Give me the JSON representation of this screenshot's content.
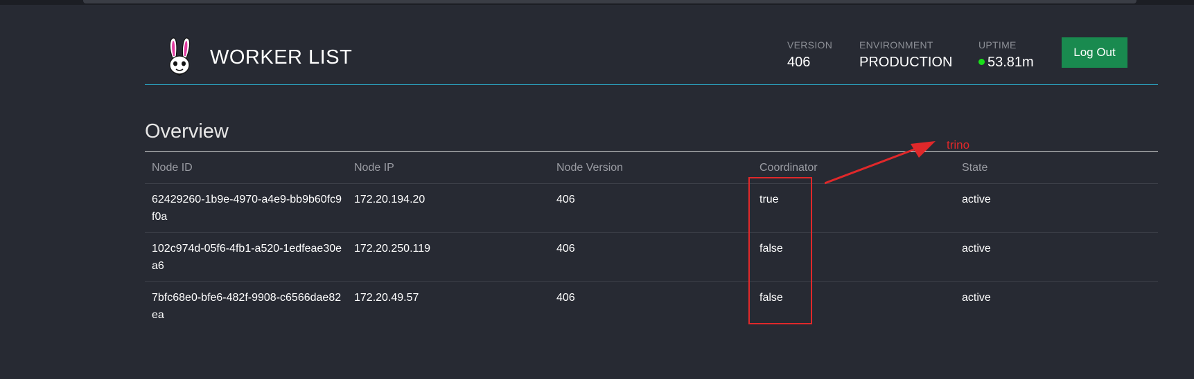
{
  "header": {
    "title": "WORKER LIST",
    "logo_icon": "bunny-logo-icon",
    "stats": {
      "version": {
        "label": "VERSION",
        "value": "406"
      },
      "environment": {
        "label": "ENVIRONMENT",
        "value": "PRODUCTION"
      },
      "uptime": {
        "label": "UPTIME",
        "value": "53.81m",
        "status_color": "#19e019"
      }
    },
    "logout_label": "Log Out"
  },
  "overview": {
    "title": "Overview",
    "columns": [
      "Node ID",
      "Node IP",
      "Node Version",
      "Coordinator",
      "State"
    ],
    "rows": [
      {
        "node_id": "62429260-1b9e-4970-a4e9-bb9b60fc9f0a",
        "node_ip": "172.20.194.20",
        "node_version": "406",
        "coordinator": "true",
        "state": "active"
      },
      {
        "node_id": "102c974d-05f6-4fb1-a520-1edfeae30ea6",
        "node_ip": "172.20.250.119",
        "node_version": "406",
        "coordinator": "false",
        "state": "active"
      },
      {
        "node_id": "7bfc68e0-bfe6-482f-9908-c6566dae82ea",
        "node_ip": "172.20.49.57",
        "node_version": "406",
        "coordinator": "false",
        "state": "active"
      }
    ]
  },
  "annotation": {
    "text": "trino",
    "color": "#e0282a"
  },
  "colors": {
    "background": "#272a33",
    "accent_line": "#2bb5d6",
    "logout_bg": "#198a4f"
  }
}
